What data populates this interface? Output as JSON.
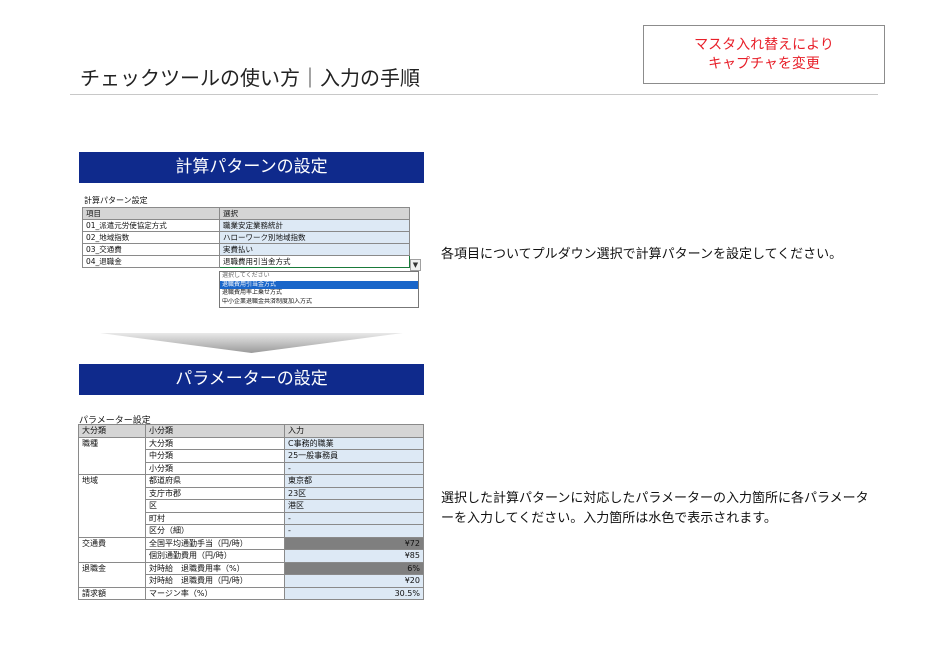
{
  "title": "チェックツールの使い方｜入力の手順",
  "notice": {
    "line1": "マスタ入れ替えにより",
    "line2": "キャプチャを変更"
  },
  "calc_section": {
    "banner": "計算パターンの設定",
    "caption": "計算パターン設定",
    "headers": {
      "item": "項目",
      "choice": "選択"
    },
    "rows": [
      {
        "item": "01_派遣元労使協定方式",
        "choice": "職業安定業務統計"
      },
      {
        "item": "02_地域指数",
        "choice": "ハローワーク別地域指数"
      },
      {
        "item": "03_交通費",
        "choice": "実費払い"
      },
      {
        "item": "04_退職金",
        "choice": "退職費用引当金方式"
      }
    ],
    "dropdown": {
      "hint": "選択してください",
      "options": [
        "退職費用引当金方式",
        "退職費用率上乗せ方式",
        "中小企業退職金共済制度加入方式"
      ]
    }
  },
  "param_section": {
    "banner": "パラメーターの設定",
    "caption": "パラメーター設定",
    "headers": {
      "major": "大分類",
      "minor": "小分類",
      "input": "入力"
    },
    "groups": {
      "job": {
        "label": "職種",
        "r1": "大分類",
        "v1": "C事務的職業",
        "r2": "中分類",
        "v2": "25一般事務員",
        "r3": "小分類",
        "v3": "-"
      },
      "region": {
        "label": "地域",
        "r1": "都道府県",
        "v1": "東京都",
        "r2": "支庁市郡",
        "v2": "23区",
        "r3": "区",
        "v3": "港区",
        "r4": "町村",
        "v4": "-",
        "r5": "区分（細）",
        "v5": "-"
      },
      "transport": {
        "label": "交通費",
        "r1": "全国平均通勤手当（円/時）",
        "v1": "¥72",
        "r2": "個別通勤費用（円/時）",
        "v2": "¥85"
      },
      "retire": {
        "label": "退職金",
        "r1": "対時給　退職費用率（%）",
        "v1": "6%",
        "r2": "対時給　退職費用（円/時）",
        "v2": "¥20"
      },
      "billing": {
        "label": "請求額",
        "r1": "マージン率（%）",
        "v1": "30.5%"
      }
    }
  },
  "desc1": "各項目についてプルダウン選択で計算パターンを設定してください。",
  "desc2": "選択した計算パターンに対応したパラメーターの入力箇所に各パラメーターを入力してください。入力箇所は水色で表示されます。"
}
